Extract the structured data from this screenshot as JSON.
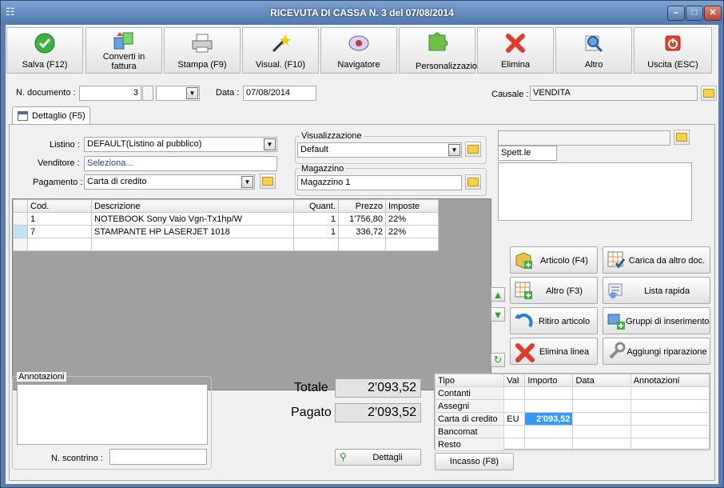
{
  "window": {
    "title": "RICEVUTA DI CASSA N. 3 del 07/08/2014",
    "app_icon": "receipt-icon"
  },
  "toolbar": [
    {
      "label": "Salva (F12)",
      "icon": "check-icon"
    },
    {
      "label": "Converti in fattura",
      "icon": "convert-icon"
    },
    {
      "label": "Stampa (F9)",
      "icon": "printer-icon"
    },
    {
      "label": "Visual. (F10)",
      "icon": "magic-wand-icon"
    },
    {
      "label": "Navigatore",
      "icon": "compass-icon"
    },
    {
      "label": "Personalizzazioni",
      "icon": "puzzle-icon"
    },
    {
      "label": "Elimina",
      "icon": "delete-x-icon"
    },
    {
      "label": "Altro",
      "icon": "magnifier-icon"
    },
    {
      "label": "Uscita (ESC)",
      "icon": "power-icon"
    }
  ],
  "header": {
    "doc_label": "N. documento :",
    "doc_number": "3",
    "doc_suffix": "",
    "date_label": "Data :",
    "date_value": "07/08/2014",
    "causale_label": "Causale :",
    "causale_value": "VENDITA"
  },
  "tab": {
    "label": "Dettaglio (F5)"
  },
  "form": {
    "listino_label": "Listino :",
    "listino_value": "DEFAULT(Listino al pubblico)",
    "venditore_label": "Venditore :",
    "venditore_value": "Seleziona...",
    "pagamento_label": "Pagamento :",
    "pagamento_value": "Carta di credito",
    "visualizzazione_title": "Visualizzazione",
    "visualizzazione_value": "Default",
    "magazzino_title": "Magazzino",
    "magazzino_value": "Magazzino 1",
    "customer_code": "",
    "customer_name": "Spett.le"
  },
  "grid": {
    "headers": [
      "Cod.",
      "Descrizione",
      "Quant.",
      "Prezzo",
      "Imposte"
    ],
    "rows": [
      [
        "1",
        "NOTEBOOK Sony Vaio Vgn-Tx1hp/W",
        "1",
        "1'756,80",
        "22%"
      ],
      [
        "7",
        "STAMPANTE HP LASERJET 1018",
        "1",
        "336,72",
        "22%"
      ]
    ]
  },
  "actions": [
    {
      "label": "Articolo (F4)",
      "icon": "box-add-icon"
    },
    {
      "label": "Carica da altro doc.",
      "icon": "grid-check-icon"
    },
    {
      "label": "Altro (F3)",
      "icon": "grid-add-icon"
    },
    {
      "label": "Lista rapida",
      "icon": "list-icon"
    },
    {
      "label": "Ritiro articolo",
      "icon": "return-arrow-icon"
    },
    {
      "label": "Gruppi di inserimento",
      "icon": "group-add-icon"
    },
    {
      "label": "Elimina linea",
      "icon": "delete-x-icon"
    },
    {
      "label": "Aggiungi riparazione",
      "icon": "wrench-icon"
    }
  ],
  "notes": {
    "title": "Annotazioni",
    "text": "",
    "scontrino_label": "N. scontrino :",
    "scontrino_value": ""
  },
  "totals": {
    "totale_label": "Totale",
    "totale_value": "2'093,52",
    "pagato_label": "Pagato",
    "pagato_value": "2'093,52",
    "dettagli_label": "Dettagli"
  },
  "payments": {
    "headers": [
      "Tipo",
      "Val",
      "Importo",
      "Data",
      "Annotazioni"
    ],
    "rows": [
      [
        "Contanti",
        "",
        "",
        "",
        ""
      ],
      [
        "Assegni",
        "",
        "",
        "",
        ""
      ],
      [
        "Carta di credito",
        "EU",
        "2'093,52",
        "",
        ""
      ],
      [
        "Bancomat",
        "",
        "",
        "",
        ""
      ],
      [
        "Resto",
        "",
        "",
        "",
        ""
      ]
    ],
    "incasso_label": "Incasso (F8)"
  },
  "colors": {
    "selection": "#3399ff",
    "title_bar": "#5a7fb0"
  }
}
